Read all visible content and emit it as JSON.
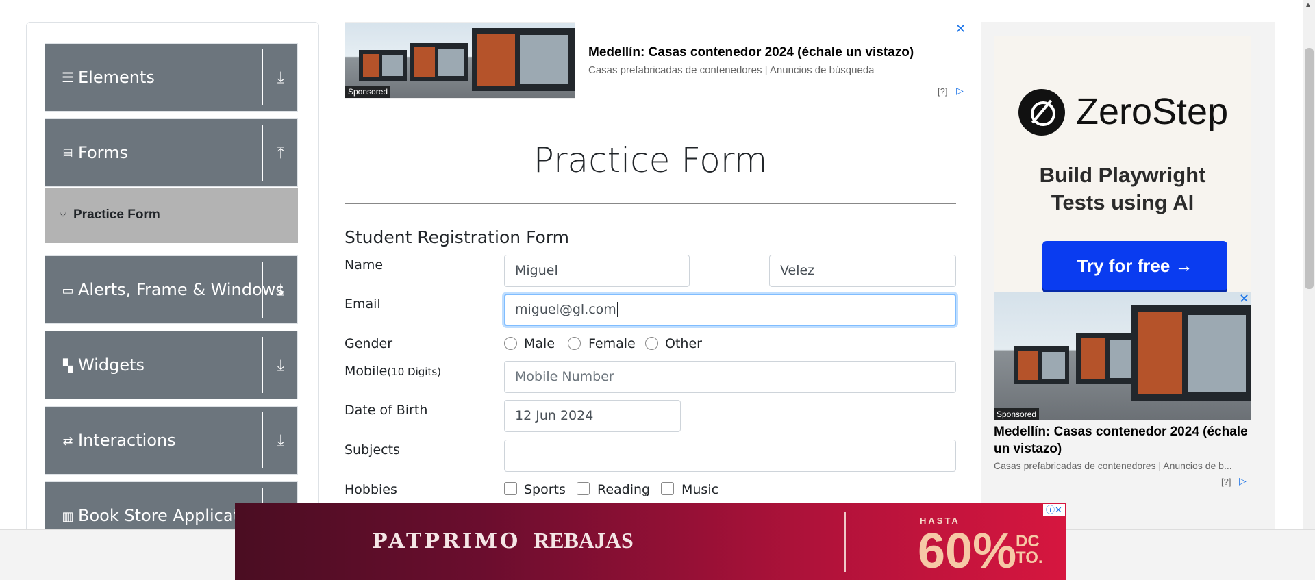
{
  "sidebar": {
    "groups": [
      {
        "label": "Elements",
        "icon": "hamburger-icon",
        "toggle": "down"
      },
      {
        "label": "Forms",
        "icon": "document-icon",
        "toggle": "up"
      },
      {
        "label": "Alerts, Frame & Windows",
        "icon": "window-icon",
        "toggle": "down"
      },
      {
        "label": "Widgets",
        "icon": "widgets-icon",
        "toggle": "down"
      },
      {
        "label": "Interactions",
        "icon": "interactions-icon",
        "toggle": "down"
      },
      {
        "label": "Book Store Application",
        "icon": "books-icon",
        "toggle": "down"
      }
    ],
    "active_item": "Practice Form"
  },
  "top_ad": {
    "headline": "Medellín: Casas contenedor 2024 (échale un vistazo)",
    "description": "Casas prefabricadas de contenedores | Anuncios de búsqueda",
    "sponsored": "Sponsored",
    "info": "[?]"
  },
  "page": {
    "title": "Practice Form",
    "form_title": "Student Registration Form"
  },
  "form": {
    "name_label": "Name",
    "first_name": "Miguel",
    "last_name": "Velez",
    "email_label": "Email",
    "email": "miguel@gl.com",
    "gender_label": "Gender",
    "genders": [
      "Male",
      "Female",
      "Other"
    ],
    "mobile_label": "Mobile",
    "mobile_hint": "(10 Digits)",
    "mobile_placeholder": "Mobile Number",
    "dob_label": "Date of Birth",
    "dob": "12 Jun 2024",
    "subjects_label": "Subjects",
    "hobbies_label": "Hobbies",
    "hobbies": [
      "Sports",
      "Reading",
      "Music"
    ]
  },
  "right_ad": {
    "brand": "ZeroStep",
    "tagline_1": "Build Playwright",
    "tagline_2": "Tests using AI",
    "cta": "Try for free →",
    "sponsored": "Sponsored",
    "headline": "Medellín: Casas contenedor 2024 (échale un vistazo)",
    "description": "Casas prefabricadas de contenedores | Anuncios de b...",
    "info": "[?]"
  },
  "bottom_banner": {
    "brand": "PATPRIMO",
    "sale": "REBAJAS",
    "hasta": "HASTA",
    "percent": "60%",
    "dcto_1": "DC",
    "dcto_2": "TO."
  },
  "colors": {
    "sidebar_group": "#6c757d",
    "active_item": "#b3b3b3",
    "focus_border": "#80bdff",
    "cta_blue": "#0a3cf0"
  }
}
